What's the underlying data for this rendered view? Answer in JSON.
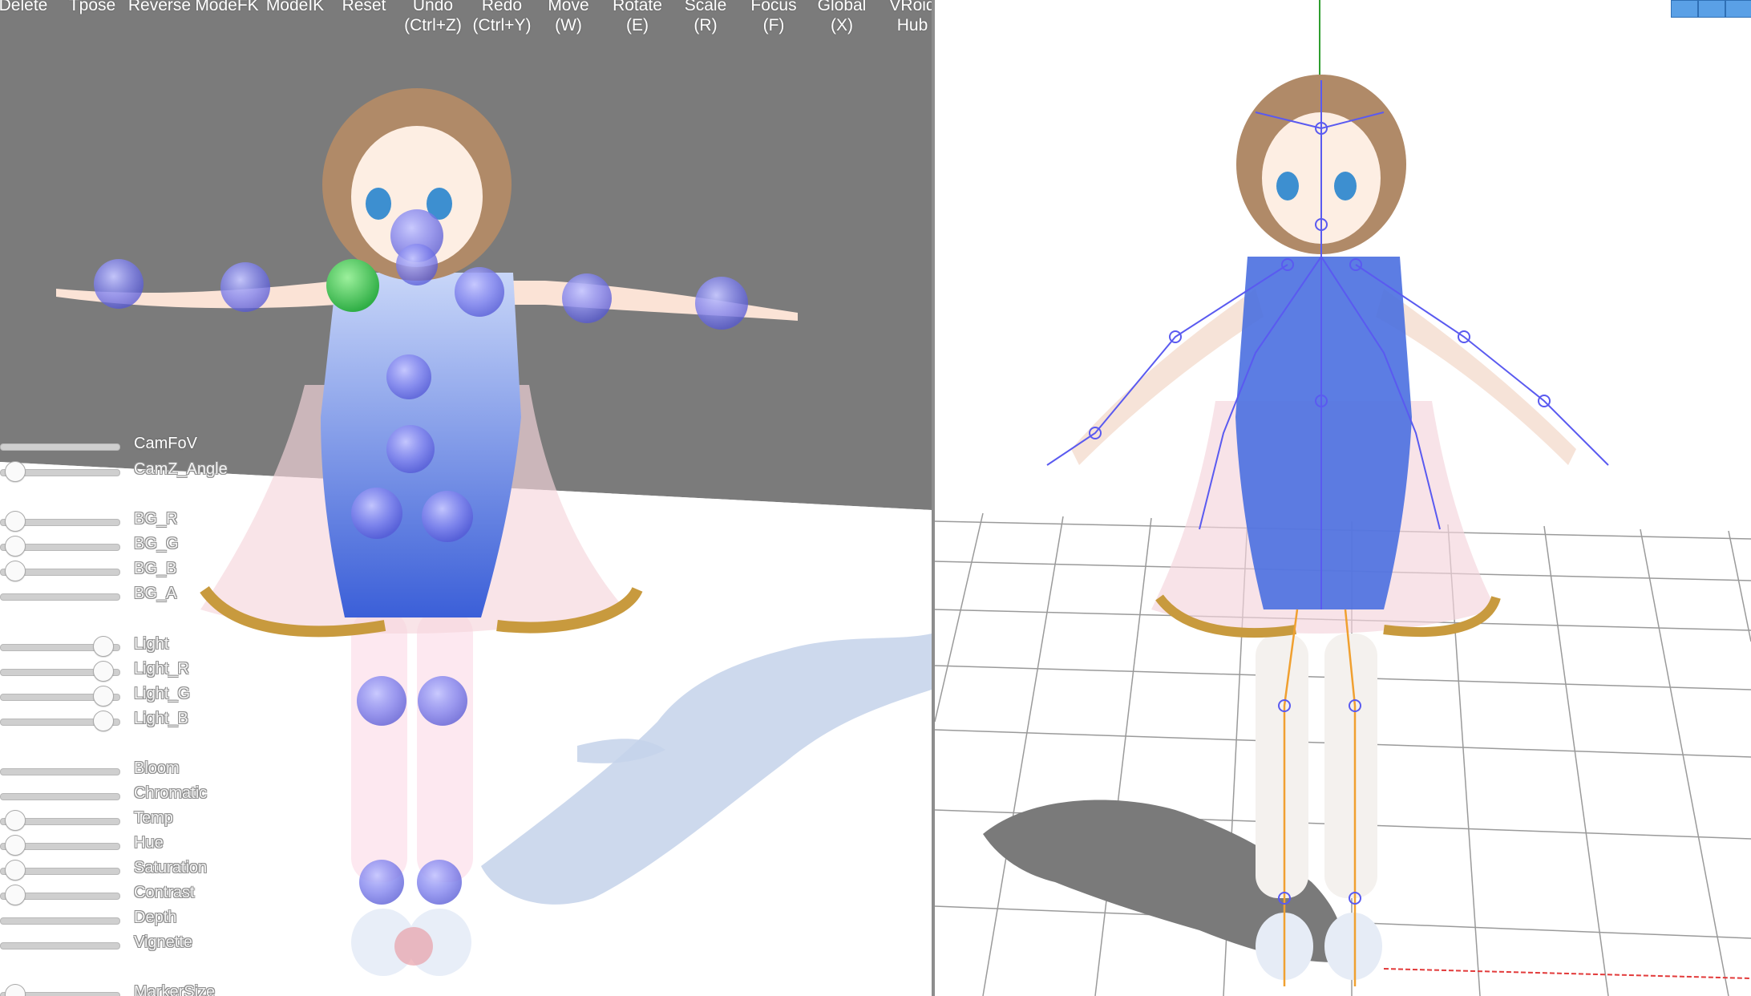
{
  "toolbar": {
    "buttons": [
      {
        "label": "Delete"
      },
      {
        "label": "Tpose"
      },
      {
        "label": "Reverse"
      },
      {
        "label": "ModeFK"
      },
      {
        "label": "ModeIK"
      },
      {
        "label": "Reset"
      },
      {
        "label": "Undo\n(Ctrl+Z)"
      },
      {
        "label": "Redo\n(Ctrl+Y)"
      },
      {
        "label": "Move\n(W)"
      },
      {
        "label": "Rotate\n(E)"
      },
      {
        "label": "Scale\n(R)"
      },
      {
        "label": "Focus\n(F)"
      },
      {
        "label": "Global\n(X)"
      },
      {
        "label": "VRoid\nHub"
      }
    ]
  },
  "settings": {
    "sliders": [
      {
        "label": "CamFoV",
        "value": 1.0
      },
      {
        "label": "CamZ_Angle",
        "value": 0.13
      },
      {
        "label": "BG_R",
        "value": 0.13
      },
      {
        "label": "BG_G",
        "value": 0.13
      },
      {
        "label": "BG_B",
        "value": 0.13
      },
      {
        "label": "BG_A",
        "value": 1.0
      },
      {
        "label": "Light",
        "value": 0.87
      },
      {
        "label": "Light_R",
        "value": 0.87
      },
      {
        "label": "Light_G",
        "value": 0.87
      },
      {
        "label": "Light_B",
        "value": 0.87
      },
      {
        "label": "Bloom",
        "value": 1.0
      },
      {
        "label": "Chromatic",
        "value": 1.0
      },
      {
        "label": "Temp",
        "value": 0.13
      },
      {
        "label": "Hue",
        "value": 0.13
      },
      {
        "label": "Saturation",
        "value": 0.13
      },
      {
        "label": "Contrast",
        "value": 0.13
      },
      {
        "label": "Depth",
        "value": 1.0
      },
      {
        "label": "Vignette",
        "value": 1.0
      },
      {
        "label": "MarkerSize",
        "value": 0.13
      }
    ]
  },
  "colors": {
    "viewport_background": "#7b7b7b",
    "floor": "#ffffff",
    "joint_marker": "#8b8cf0",
    "bone_lines": "#5a5af0",
    "leg_bones": "#f0a030",
    "hair": "#b08a68",
    "dress": "#4a6fe0"
  }
}
